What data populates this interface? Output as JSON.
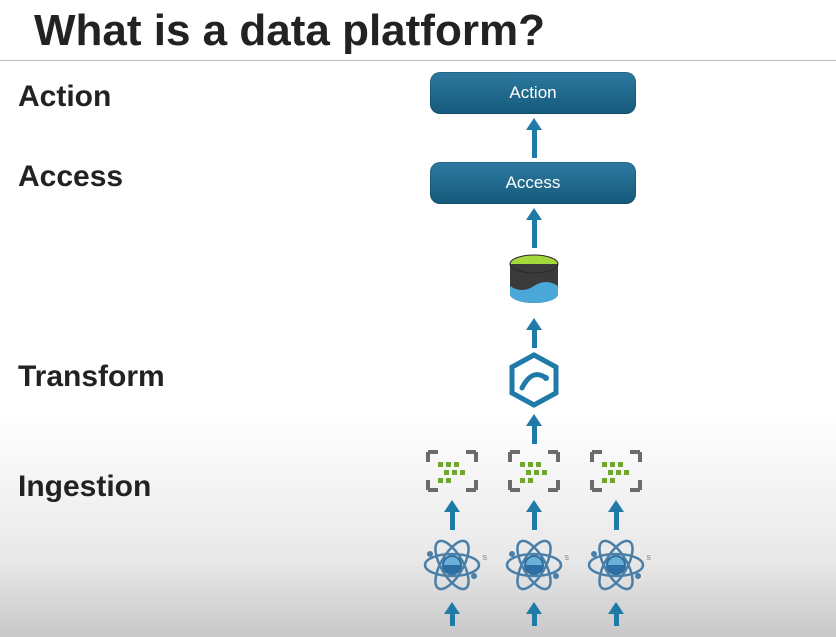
{
  "title": "What is a data platform?",
  "labels": {
    "action": "Action",
    "access": "Access",
    "transform": "Transform",
    "ingestion": "Ingestion"
  },
  "pills": {
    "action": "Action",
    "access": "Access"
  },
  "icons": {
    "datalake": "datalake-icon",
    "transform": "hexagon-transform-icon",
    "pipeline": "pipeline-bracket-icon",
    "source": "atom-source-icon"
  },
  "colors": {
    "arrow": "#1f7aa8",
    "pill_top": "#2d7aa0",
    "pill_bottom": "#15597b",
    "bracket": "#6b6b6b",
    "green": "#89c23c",
    "hex": "#1f7aa8"
  },
  "source_badge": "s",
  "diagram": {
    "layers": [
      "Action",
      "Access",
      "Storage",
      "Transform",
      "Ingestion",
      "Sources"
    ],
    "flows": [
      {
        "from": "Access",
        "to": "Action"
      },
      {
        "from": "Storage",
        "to": "Access"
      },
      {
        "from": "Transform",
        "to": "Storage"
      },
      {
        "from": "Ingestion",
        "to": "Transform"
      },
      {
        "from": "Sources",
        "to": "Ingestion"
      }
    ],
    "multiplicity": {
      "Ingestion": 3,
      "Sources": 3
    }
  }
}
